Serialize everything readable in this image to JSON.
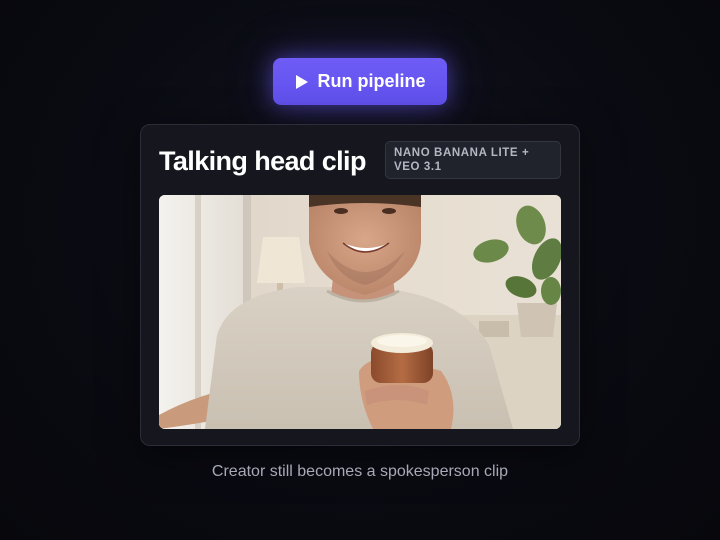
{
  "run_button": {
    "label": "Run pipeline",
    "icon": "play-icon"
  },
  "card": {
    "title": "Talking head clip",
    "badge": "NANO BANANA LITE + VEO 3.1"
  },
  "caption": "Creator still becomes a spokesperson clip",
  "colors": {
    "accent": "#6b57f4",
    "background": "#0a0b12",
    "card": "#15161e"
  }
}
